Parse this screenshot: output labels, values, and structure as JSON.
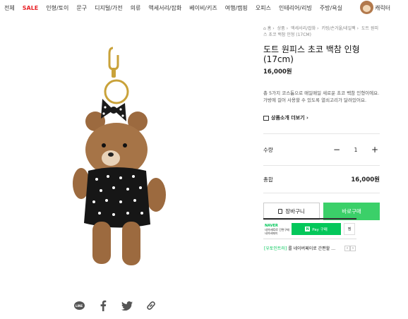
{
  "nav": {
    "items": [
      "전체",
      "SALE",
      "인형/토이",
      "문구",
      "디지털/가전",
      "의류",
      "액세서리/잡화",
      "베이비/키즈",
      "여행/캠핑",
      "오피스",
      "인테리어/리빙",
      "주방/욕실"
    ],
    "character_label": "캐릭터"
  },
  "breadcrumb": {
    "items": [
      "홈",
      "상품",
      "액세서리/잡화",
      "키링/손거울/네일팩",
      "도트 원피스 초코 백참 인형 (17CM)"
    ]
  },
  "product": {
    "title": "도트 원피스 초코 백참 인형 (17cm)",
    "price": "16,000원",
    "description": "총 5가지 코스튬으로 매일매일 새로운 초코 백참 인형이에요. 가방에 걸어 사용할 수 있도록 열쇠고리가 달려있어요.",
    "more_label": "상품소개 더보기 ›",
    "quantity_label": "수량",
    "quantity": "1",
    "minus": "−",
    "plus": "+",
    "total_label": "총합",
    "total_value": "16,000원",
    "cart_label": "장바구니",
    "buy_label": "바로구매"
  },
  "naver": {
    "brand": "NAVER",
    "note_1": "네이버ID로 간편구매",
    "note_2": "네이버페이",
    "pay_n": "N",
    "pay_label": "Pay 구매",
    "zzim_label": "찜"
  },
  "promo": {
    "tag": "[우토인트러]",
    "text": "를 네이버페이로 간편할 …",
    "prev": "‹",
    "next": "›"
  },
  "share": {
    "line_label": "LINE"
  },
  "colors": {
    "sale": "#e8242a",
    "buy_button": "#3bd069",
    "naver_green": "#03c75a"
  }
}
